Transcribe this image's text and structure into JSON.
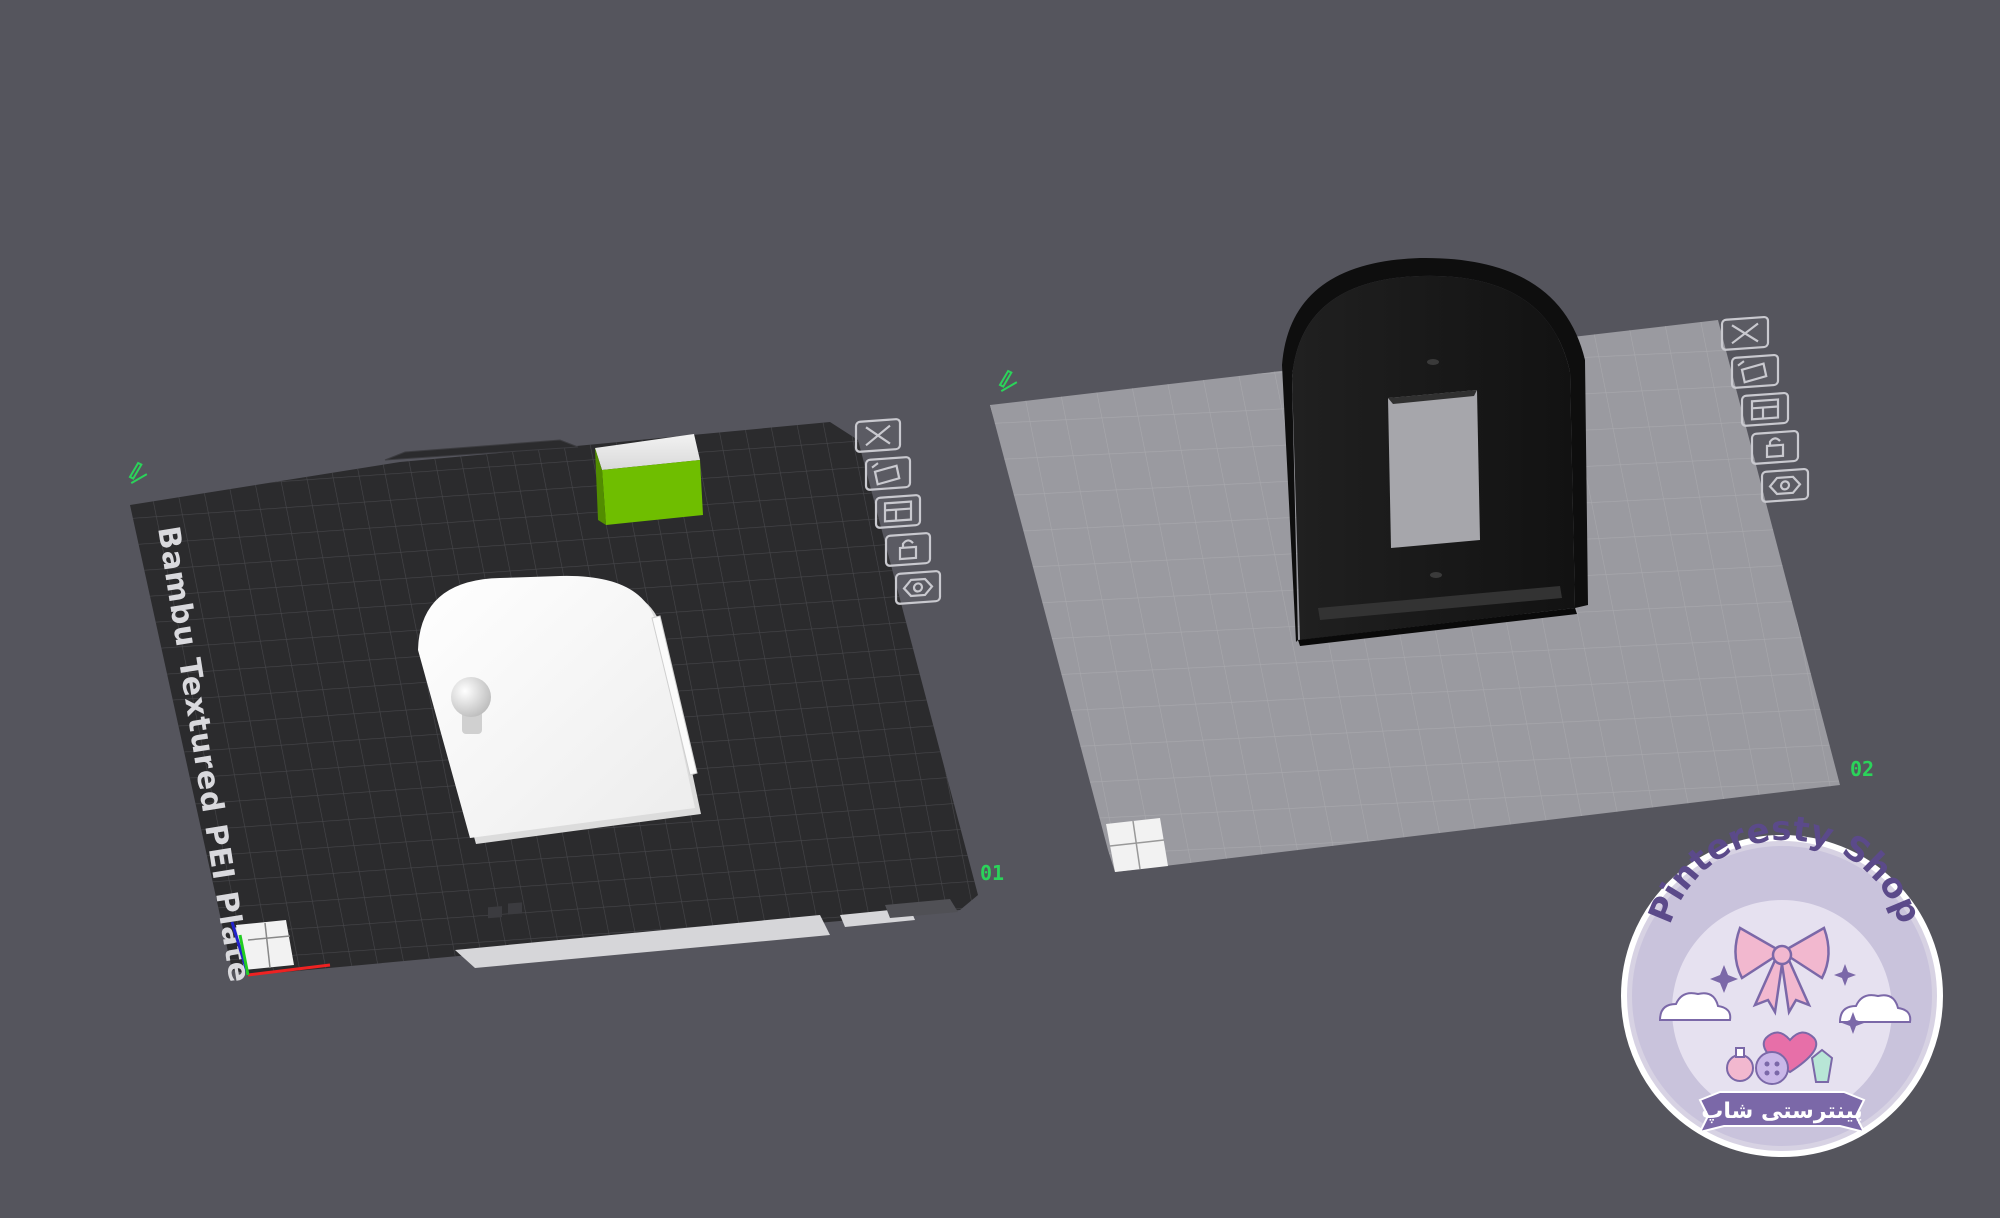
{
  "plates": [
    {
      "number": "01",
      "bed_label": "Bambu Textured PEI Plate",
      "tools": [
        {
          "name": "close-icon"
        },
        {
          "name": "auto-orient-icon"
        },
        {
          "name": "arrange-icon"
        },
        {
          "name": "lock-icon"
        },
        {
          "name": "settings-icon"
        }
      ]
    },
    {
      "number": "02",
      "tools": [
        {
          "name": "close-icon"
        },
        {
          "name": "auto-orient-icon"
        },
        {
          "name": "arrange-icon"
        },
        {
          "name": "lock-icon"
        },
        {
          "name": "settings-icon"
        }
      ]
    }
  ],
  "watermark": {
    "title": "Pinteresty Shop",
    "subtitle": "پینترستی شاپ",
    "colors": {
      "ring": "#c9c3dc",
      "inner": "#e6e1f0",
      "bow": "#f2b8cf",
      "ribbon": "#7b68a8"
    }
  },
  "colors": {
    "background": "#55555d",
    "plate1": "#2b2b2d",
    "plate2": "#9a9aa0",
    "accent_green": "#2bd35a",
    "cube_green": "#6fbe00",
    "part_white": "#f4f4f4",
    "part_black": "#151515"
  }
}
